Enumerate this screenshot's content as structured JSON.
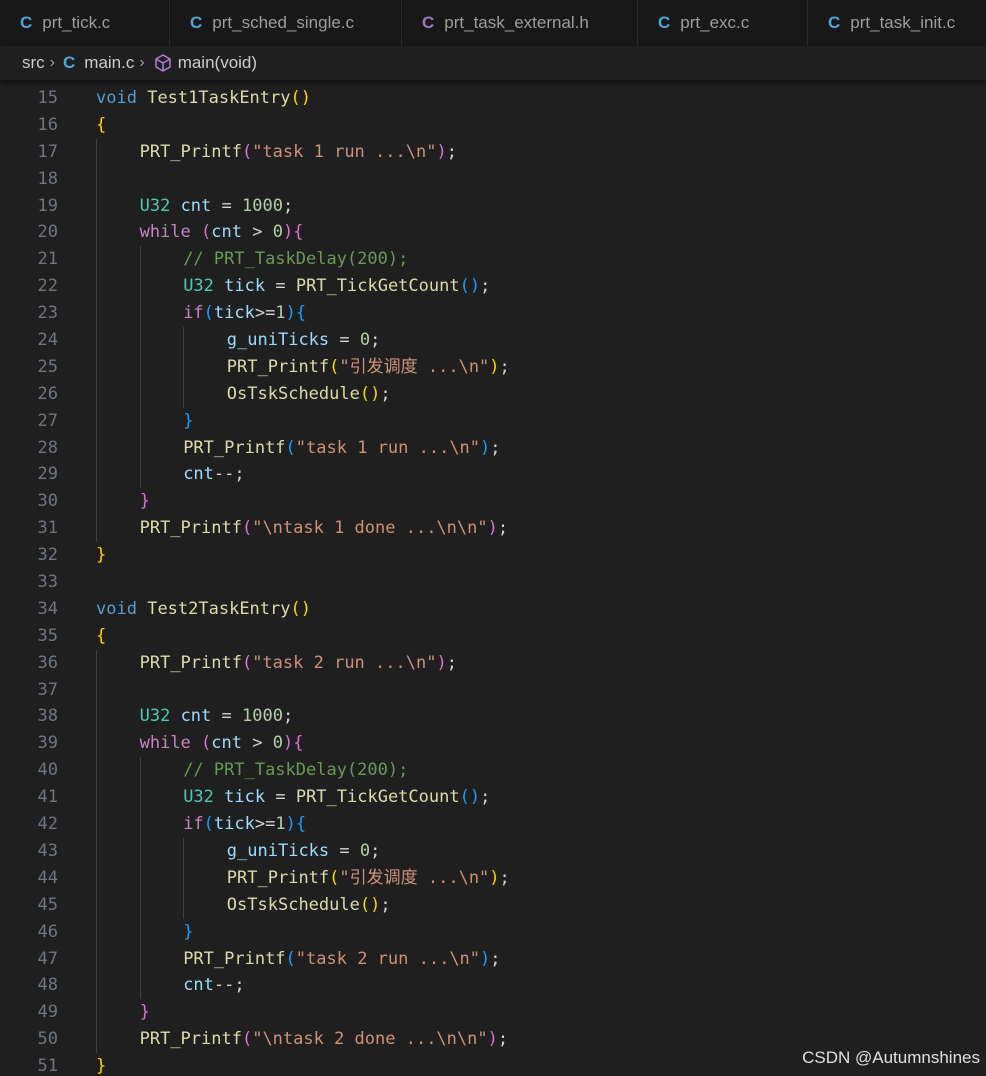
{
  "tabs": [
    {
      "icon": "C",
      "label": "prt_tick.c",
      "icon_color": "#4fa6d8"
    },
    {
      "icon": "C",
      "label": "prt_sched_single.c",
      "icon_color": "#4fa6d8"
    },
    {
      "icon": "C",
      "label": "prt_task_external.h",
      "icon_color": "#a074c4"
    },
    {
      "icon": "C",
      "label": "prt_exc.c",
      "icon_color": "#4fa6d8"
    },
    {
      "icon": "C",
      "label": "prt_task_init.c",
      "icon_color": "#4fa6d8"
    }
  ],
  "breadcrumb": {
    "folder": "src",
    "file_icon": "C",
    "file": "main.c",
    "symbol_icon": "cube-icon",
    "symbol": "main(void)"
  },
  "colors": {
    "keyword": "#569cd6",
    "control": "#c586c0",
    "type": "#4ec9b0",
    "function": "#dcdcaa",
    "string": "#ce9178",
    "number": "#b5cea8",
    "variable": "#9cdcfe",
    "comment": "#6a9955",
    "bracket_1": "#ffd700",
    "bracket_2": "#da70d6",
    "bracket_3": "#179fff"
  },
  "code_lines": [
    {
      "n": "15",
      "indent": 0,
      "tokens": [
        [
          "k",
          "void"
        ],
        [
          "p",
          " "
        ],
        [
          "f",
          "Test1TaskEntry"
        ],
        [
          "b1",
          "()"
        ]
      ]
    },
    {
      "n": "16",
      "indent": 0,
      "tokens": [
        [
          "b1",
          "{"
        ]
      ]
    },
    {
      "n": "17",
      "indent": 1,
      "tokens": [
        [
          "f",
          "PRT_Printf"
        ],
        [
          "b2",
          "("
        ],
        [
          "s",
          "\"task 1 run ...\\n\""
        ],
        [
          "b2",
          ")"
        ],
        [
          "p",
          ";"
        ]
      ]
    },
    {
      "n": "18",
      "indent": 1,
      "tokens": []
    },
    {
      "n": "19",
      "indent": 1,
      "tokens": [
        [
          "t",
          "U32"
        ],
        [
          "p",
          " "
        ],
        [
          "v",
          "cnt"
        ],
        [
          "p",
          " = "
        ],
        [
          "n",
          "1000"
        ],
        [
          "p",
          ";"
        ]
      ]
    },
    {
      "n": "20",
      "indent": 1,
      "tokens": [
        [
          "c",
          "while"
        ],
        [
          "p",
          " "
        ],
        [
          "b2",
          "("
        ],
        [
          "v",
          "cnt"
        ],
        [
          "p",
          " > "
        ],
        [
          "n",
          "0"
        ],
        [
          "b2",
          ")"
        ],
        [
          "b2",
          "{"
        ]
      ]
    },
    {
      "n": "21",
      "indent": 2,
      "tokens": [
        [
          "m",
          "// PRT_TaskDelay(200);"
        ]
      ]
    },
    {
      "n": "22",
      "indent": 2,
      "tokens": [
        [
          "t",
          "U32"
        ],
        [
          "p",
          " "
        ],
        [
          "v",
          "tick"
        ],
        [
          "p",
          " = "
        ],
        [
          "f",
          "PRT_TickGetCount"
        ],
        [
          "b3",
          "()"
        ],
        [
          "p",
          ";"
        ]
      ]
    },
    {
      "n": "23",
      "indent": 2,
      "tokens": [
        [
          "c",
          "if"
        ],
        [
          "b3",
          "("
        ],
        [
          "v",
          "tick"
        ],
        [
          "p",
          ">="
        ],
        [
          "n",
          "1"
        ],
        [
          "b3",
          ")"
        ],
        [
          "b3",
          "{"
        ]
      ]
    },
    {
      "n": "24",
      "indent": 3,
      "tokens": [
        [
          "v",
          "g_uniTicks"
        ],
        [
          "p",
          " = "
        ],
        [
          "n",
          "0"
        ],
        [
          "p",
          ";"
        ]
      ]
    },
    {
      "n": "25",
      "indent": 3,
      "tokens": [
        [
          "f",
          "PRT_Printf"
        ],
        [
          "b1",
          "("
        ],
        [
          "s",
          "\"引发调度 ...\\n\""
        ],
        [
          "b1",
          ")"
        ],
        [
          "p",
          ";"
        ]
      ]
    },
    {
      "n": "26",
      "indent": 3,
      "tokens": [
        [
          "f",
          "OsTskSchedule"
        ],
        [
          "b1",
          "()"
        ],
        [
          "p",
          ";"
        ]
      ]
    },
    {
      "n": "27",
      "indent": 2,
      "tokens": [
        [
          "b3",
          "}"
        ]
      ]
    },
    {
      "n": "28",
      "indent": 2,
      "tokens": [
        [
          "f",
          "PRT_Printf"
        ],
        [
          "b3",
          "("
        ],
        [
          "s",
          "\"task 1 run ...\\n\""
        ],
        [
          "b3",
          ")"
        ],
        [
          "p",
          ";"
        ]
      ]
    },
    {
      "n": "29",
      "indent": 2,
      "tokens": [
        [
          "v",
          "cnt"
        ],
        [
          "p",
          "--;"
        ]
      ]
    },
    {
      "n": "30",
      "indent": 1,
      "tokens": [
        [
          "b2",
          "}"
        ]
      ]
    },
    {
      "n": "31",
      "indent": 1,
      "tokens": [
        [
          "f",
          "PRT_Printf"
        ],
        [
          "b2",
          "("
        ],
        [
          "s",
          "\"\\ntask 1 done ...\\n\\n\""
        ],
        [
          "b2",
          ")"
        ],
        [
          "p",
          ";"
        ]
      ]
    },
    {
      "n": "32",
      "indent": 0,
      "tokens": [
        [
          "b1",
          "}"
        ]
      ]
    },
    {
      "n": "33",
      "indent": 0,
      "tokens": []
    },
    {
      "n": "34",
      "indent": 0,
      "tokens": [
        [
          "k",
          "void"
        ],
        [
          "p",
          " "
        ],
        [
          "f",
          "Test2TaskEntry"
        ],
        [
          "b1",
          "()"
        ]
      ]
    },
    {
      "n": "35",
      "indent": 0,
      "tokens": [
        [
          "b1",
          "{"
        ]
      ]
    },
    {
      "n": "36",
      "indent": 1,
      "tokens": [
        [
          "f",
          "PRT_Printf"
        ],
        [
          "b2",
          "("
        ],
        [
          "s",
          "\"task 2 run ...\\n\""
        ],
        [
          "b2",
          ")"
        ],
        [
          "p",
          ";"
        ]
      ]
    },
    {
      "n": "37",
      "indent": 1,
      "tokens": []
    },
    {
      "n": "38",
      "indent": 1,
      "tokens": [
        [
          "t",
          "U32"
        ],
        [
          "p",
          " "
        ],
        [
          "v",
          "cnt"
        ],
        [
          "p",
          " = "
        ],
        [
          "n",
          "1000"
        ],
        [
          "p",
          ";"
        ]
      ]
    },
    {
      "n": "39",
      "indent": 1,
      "tokens": [
        [
          "c",
          "while"
        ],
        [
          "p",
          " "
        ],
        [
          "b2",
          "("
        ],
        [
          "v",
          "cnt"
        ],
        [
          "p",
          " > "
        ],
        [
          "n",
          "0"
        ],
        [
          "b2",
          ")"
        ],
        [
          "b2",
          "{"
        ]
      ]
    },
    {
      "n": "40",
      "indent": 2,
      "tokens": [
        [
          "m",
          "// PRT_TaskDelay(200);"
        ]
      ]
    },
    {
      "n": "41",
      "indent": 2,
      "tokens": [
        [
          "t",
          "U32"
        ],
        [
          "p",
          " "
        ],
        [
          "v",
          "tick"
        ],
        [
          "p",
          " = "
        ],
        [
          "f",
          "PRT_TickGetCount"
        ],
        [
          "b3",
          "()"
        ],
        [
          "p",
          ";"
        ]
      ]
    },
    {
      "n": "42",
      "indent": 2,
      "tokens": [
        [
          "c",
          "if"
        ],
        [
          "b3",
          "("
        ],
        [
          "v",
          "tick"
        ],
        [
          "p",
          ">="
        ],
        [
          "n",
          "1"
        ],
        [
          "b3",
          ")"
        ],
        [
          "b3",
          "{"
        ]
      ]
    },
    {
      "n": "43",
      "indent": 3,
      "tokens": [
        [
          "v",
          "g_uniTicks"
        ],
        [
          "p",
          " = "
        ],
        [
          "n",
          "0"
        ],
        [
          "p",
          ";"
        ]
      ]
    },
    {
      "n": "44",
      "indent": 3,
      "tokens": [
        [
          "f",
          "PRT_Printf"
        ],
        [
          "b1",
          "("
        ],
        [
          "s",
          "\"引发调度 ...\\n\""
        ],
        [
          "b1",
          ")"
        ],
        [
          "p",
          ";"
        ]
      ]
    },
    {
      "n": "45",
      "indent": 3,
      "tokens": [
        [
          "f",
          "OsTskSchedule"
        ],
        [
          "b1",
          "()"
        ],
        [
          "p",
          ";"
        ]
      ]
    },
    {
      "n": "46",
      "indent": 2,
      "tokens": [
        [
          "b3",
          "}"
        ]
      ]
    },
    {
      "n": "47",
      "indent": 2,
      "tokens": [
        [
          "f",
          "PRT_Printf"
        ],
        [
          "b3",
          "("
        ],
        [
          "s",
          "\"task 2 run ...\\n\""
        ],
        [
          "b3",
          ")"
        ],
        [
          "p",
          ";"
        ]
      ]
    },
    {
      "n": "48",
      "indent": 2,
      "tokens": [
        [
          "v",
          "cnt"
        ],
        [
          "p",
          "--;"
        ]
      ]
    },
    {
      "n": "49",
      "indent": 1,
      "tokens": [
        [
          "b2",
          "}"
        ]
      ]
    },
    {
      "n": "50",
      "indent": 1,
      "tokens": [
        [
          "f",
          "PRT_Printf"
        ],
        [
          "b2",
          "("
        ],
        [
          "s",
          "\"\\ntask 2 done ...\\n\\n\""
        ],
        [
          "b2",
          ")"
        ],
        [
          "p",
          ";"
        ]
      ]
    },
    {
      "n": "51",
      "indent": 0,
      "tokens": [
        [
          "b1",
          "}"
        ]
      ]
    }
  ],
  "watermark": "CSDN @Autumnshines"
}
